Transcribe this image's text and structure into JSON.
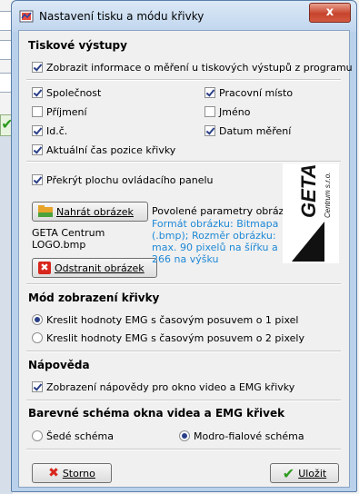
{
  "window": {
    "title": "Nastavení tisku a módu křivky",
    "close_label": "x"
  },
  "print_outputs": {
    "title": "Tiskové výstupy",
    "show_info": {
      "label": "Zobrazit informace o měření u tiskových výstupů z programu",
      "checked": true
    }
  },
  "fields": [
    {
      "label": "Společnost",
      "checked": true
    },
    {
      "label": "Pracovní místo",
      "checked": true
    },
    {
      "label": "Příjmení",
      "checked": false
    },
    {
      "label": "Jméno",
      "checked": false
    },
    {
      "label": "Id.č.",
      "checked": true
    },
    {
      "label": "Datum měření",
      "checked": true
    },
    {
      "label": "Aktuální čas pozice křivky",
      "checked": true
    }
  ],
  "panel": {
    "overlay_label": "Překrýt plochu ovládacího panelu",
    "overlay_checked": true,
    "upload_button": "Nahrát obrázek",
    "remove_button": "Odstranit obrázek",
    "filename": "GETA Centrum LOGO.bmp",
    "params_title": "Povolené parametry obrázku",
    "params_text": "Formát obrázku: Bitmapa (.bmp); Rozměr obrázku: max. 90 pixelů na šířku a 266 na výšku",
    "logo_text": "GETA",
    "logo_sub": "Centrum s.r.o."
  },
  "curve_mode": {
    "title": "Mód zobrazení křivky",
    "options": [
      {
        "label": "Kreslit hodnoty EMG s časovým posuvem o 1 pixel",
        "selected": true
      },
      {
        "label": "Kreslit hodnoty EMG s časovým posuvem o 2 pixely",
        "selected": false
      }
    ]
  },
  "help": {
    "title": "Nápověda",
    "show_help": {
      "label": "Zobrazení nápovědy pro okno video a EMG křivky",
      "checked": true
    }
  },
  "color_scheme": {
    "title": "Barevné schéma okna videa a EMG křivek",
    "options": [
      {
        "label": "Šedé schéma",
        "selected": false
      },
      {
        "label": "Modro-fialové schéma",
        "selected": true
      }
    ]
  },
  "footer": {
    "cancel_label": "Storno",
    "save_label": "Uložit"
  },
  "colors": {
    "accent_blue": "#1e88d6",
    "close_red": "#c7442d",
    "check_green": "#2e9a1f",
    "cancel_red": "#d8261c"
  }
}
